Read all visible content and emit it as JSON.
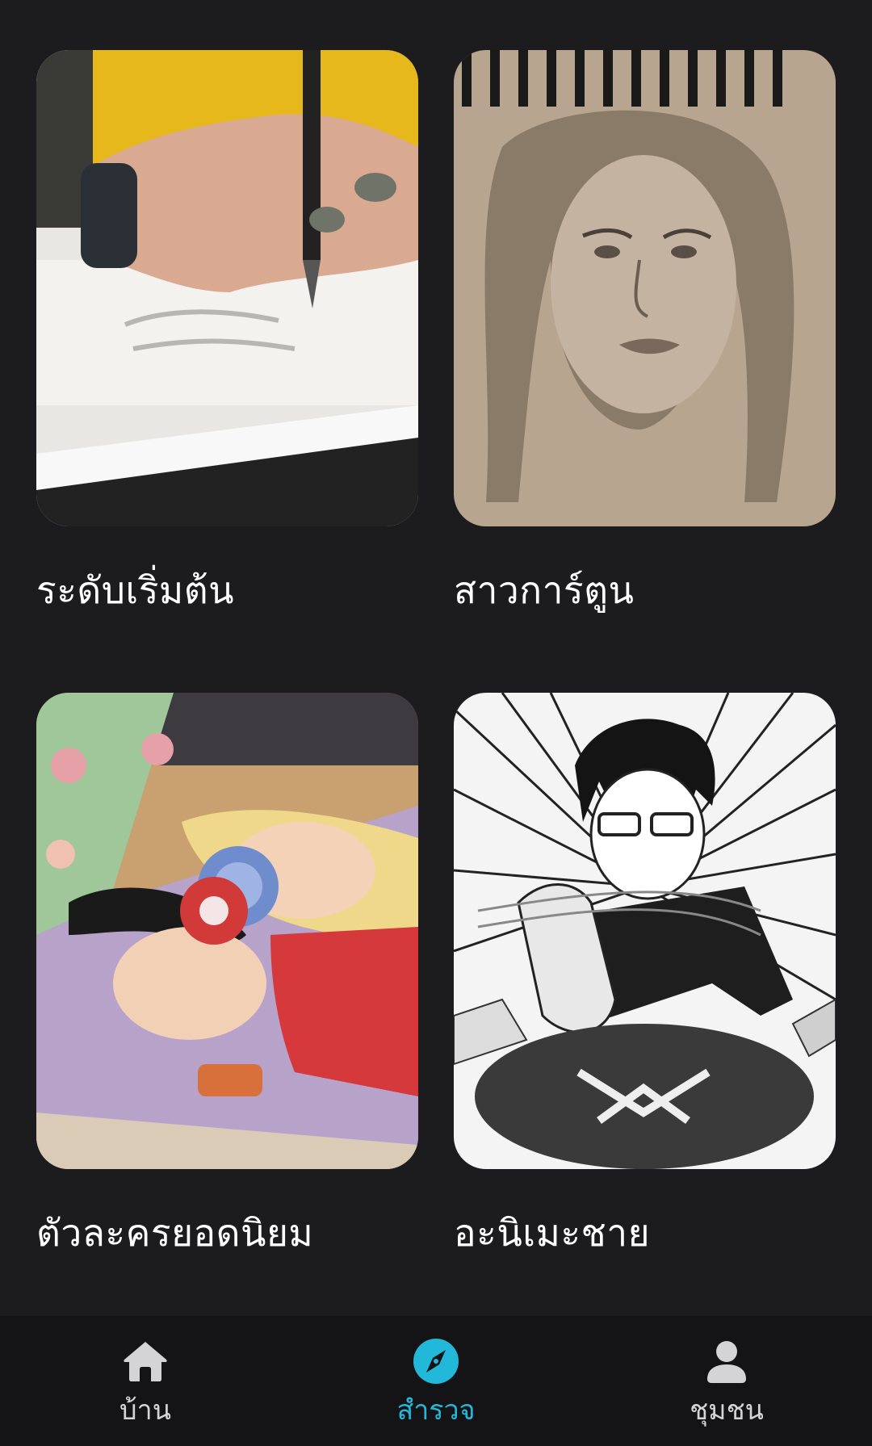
{
  "categories": [
    {
      "title": "ระดับเริ่มต้น",
      "image": "hand-drawing-with-pen"
    },
    {
      "title": "สาวการ์ตูน",
      "image": "pencil-portrait-sketch"
    },
    {
      "title": "ตัวละครยอดนิยม",
      "image": "colored-anime-illustration"
    },
    {
      "title": "อะนิเมะชาย",
      "image": "manga-boy-illustration"
    }
  ],
  "bottom_nav": {
    "items": [
      {
        "label": "บ้าน",
        "icon": "home-icon",
        "active": false
      },
      {
        "label": "สำรวจ",
        "icon": "compass-icon",
        "active": true
      },
      {
        "label": "ชุมชน",
        "icon": "person-icon",
        "active": false
      }
    ],
    "active_color": "#22b8d9",
    "inactive_color": "#d4d4d6"
  },
  "colors": {
    "background": "#1c1c1e",
    "nav_background": "#141416"
  }
}
